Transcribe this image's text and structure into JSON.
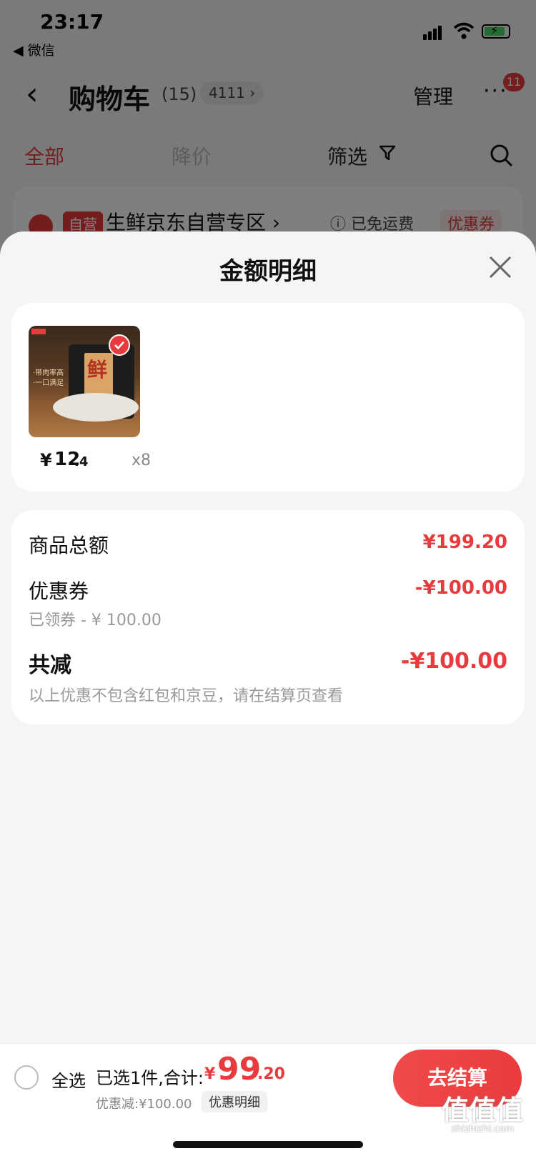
{
  "status": {
    "time": "23:17",
    "back_app": "◀ 微信"
  },
  "nav": {
    "back": "‹",
    "title": "购物车",
    "count": "(15)",
    "address": "4111 ›",
    "manage": "管理",
    "more": "···",
    "badge": "11"
  },
  "filter": {
    "all": "全部",
    "price_drop": "降价",
    "filter": "筛选"
  },
  "store": {
    "tag": "自营",
    "name": "生鲜京东自营专区 ›",
    "info": "ⓘ 已免运费",
    "coupon": "优惠券"
  },
  "sheet": {
    "title": "金额明细",
    "product": {
      "image_char": "鲜",
      "image_text": "·带肉率高\n·一口满足",
      "price_symbol": "¥",
      "price_int": "12",
      "price_dec": ".4",
      "qty": "x8"
    },
    "details": {
      "goods_total_label": "商品总额",
      "goods_total_value": "¥199.20",
      "coupon_label": "优惠券",
      "coupon_sub": "已领券 - ¥ 100.00",
      "coupon_value": "-¥100.00",
      "total_reduce_label": "共减",
      "total_reduce_value": "-¥100.00",
      "note": "以上优惠不包含红包和京豆，请在结算页查看"
    }
  },
  "bottom": {
    "select_all": "全选",
    "selected": "已选1件,合计:",
    "sum_symbol": "¥",
    "sum_int": "99",
    "sum_dec": ".20",
    "discount": "优惠减:¥100.00",
    "discount_link": "优惠明细",
    "checkout": "去结算"
  },
  "watermark": {
    "main": "值值值",
    "sub": "zhizhizhi.com"
  },
  "colors": {
    "accent": "#e93b3d",
    "sheet_bg": "#f5f5f5"
  }
}
